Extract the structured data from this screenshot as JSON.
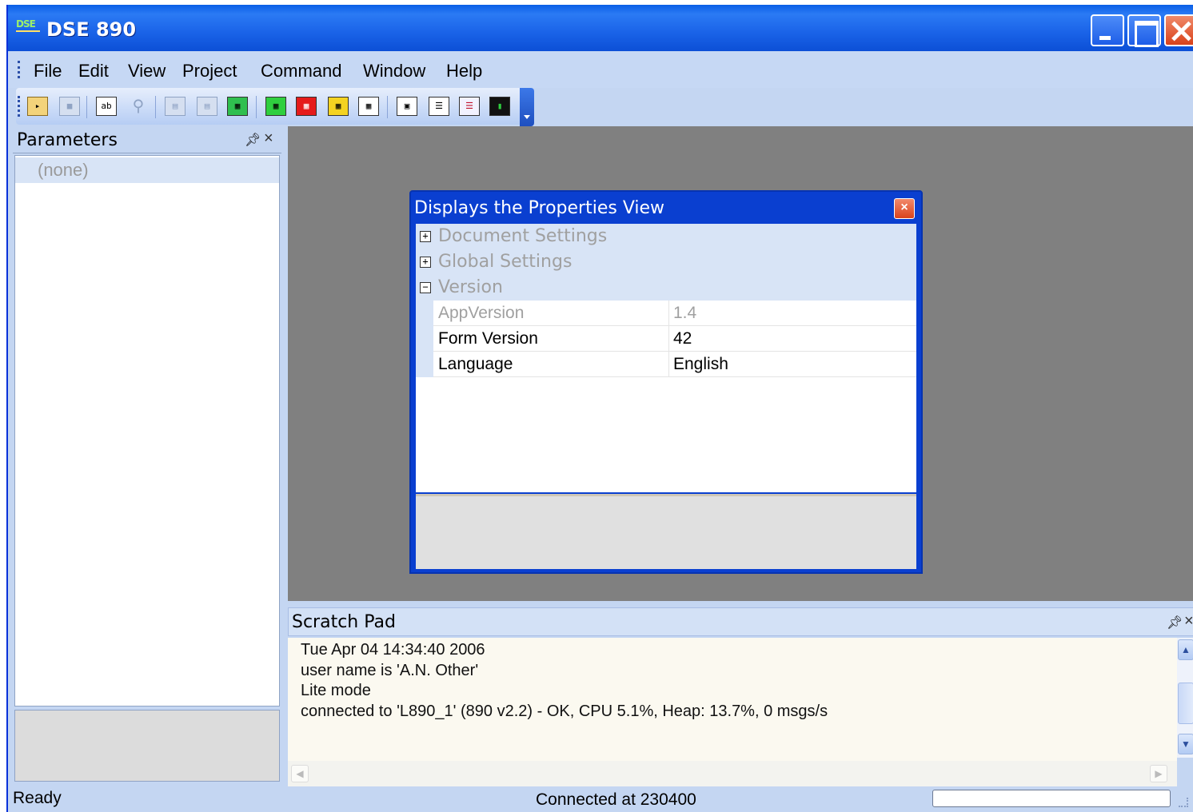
{
  "window": {
    "title": "DSE 890",
    "logo_text": "DSE"
  },
  "menu": {
    "items": [
      "File",
      "Edit",
      "View",
      "Project",
      "Command",
      "Window",
      "Help"
    ]
  },
  "toolbar": {
    "icons": [
      "open-folder-icon",
      "save-icon",
      "rename-icon",
      "find-icon",
      "form-icon",
      "form-icon",
      "form-grid-icon",
      "form-green-icon",
      "form-red-icon",
      "form-yellow-icon",
      "form-table-icon",
      "layout-icon",
      "list-icon",
      "report-icon",
      "monitor-icon"
    ]
  },
  "parameters": {
    "title": "Parameters",
    "empty_label": "(none)"
  },
  "properties_dialog": {
    "title": "Displays the Properties View",
    "categories": [
      {
        "label": "Document Settings",
        "expanded": false
      },
      {
        "label": "Global Settings",
        "expanded": false
      },
      {
        "label": "Version",
        "expanded": true
      }
    ],
    "rows": [
      {
        "name": "AppVersion",
        "value": "1.4",
        "readonly": true
      },
      {
        "name": "Form Version",
        "value": "42",
        "readonly": false
      },
      {
        "name": "Language",
        "value": "English",
        "readonly": false
      }
    ]
  },
  "scratch_pad": {
    "title": "Scratch Pad",
    "lines": [
      "Tue Apr 04 14:34:40 2006",
      "user name is 'A.N. Other'",
      "Lite mode",
      "connected to 'L890_1' (890 v2.2) - OK, CPU 5.1%, Heap: 13.7%, 0 msgs/s"
    ]
  },
  "status": {
    "left": "Ready",
    "center": "Connected at 230400"
  },
  "colors": {
    "titlebar": "#1a63e8",
    "chrome": "#c4d6f2",
    "workspace": "#808080",
    "close": "#d9421a"
  }
}
